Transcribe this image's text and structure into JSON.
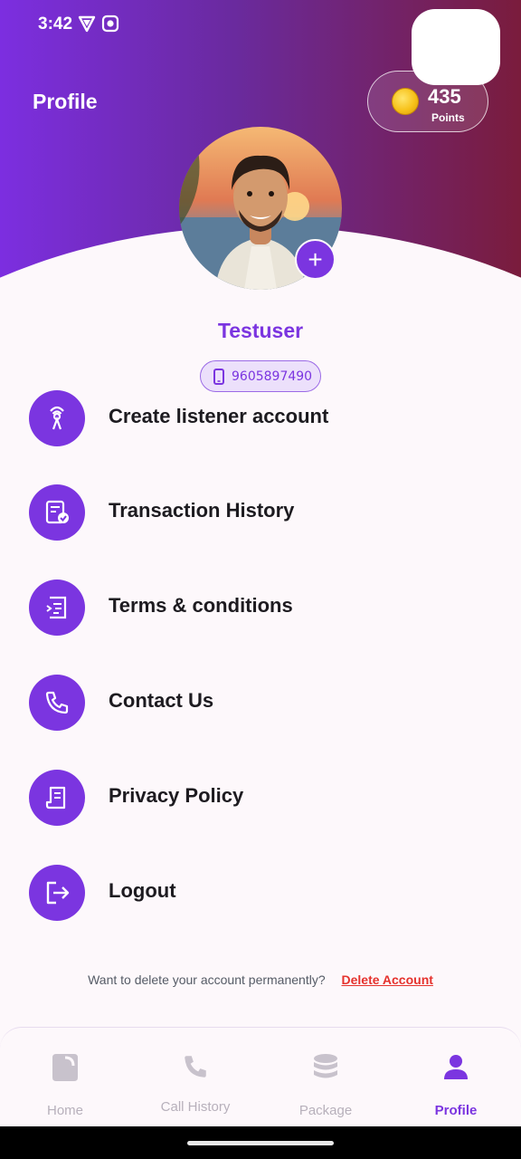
{
  "status_bar": {
    "time": "3:42"
  },
  "header": {
    "title": "Profile",
    "points": {
      "value": "435",
      "label": "Points"
    }
  },
  "profile": {
    "name": "Testuser",
    "phone": "9605897490"
  },
  "menu": [
    {
      "label": "Create listener account",
      "icon": "listener-icon"
    },
    {
      "label": "Transaction History",
      "icon": "transaction-icon"
    },
    {
      "label": "Terms & conditions",
      "icon": "terms-icon"
    },
    {
      "label": "Contact Us",
      "icon": "phone-icon"
    },
    {
      "label": "Privacy Policy",
      "icon": "document-icon"
    },
    {
      "label": "Logout",
      "icon": "logout-icon"
    }
  ],
  "delete_account": {
    "prompt": "Want to delete your account permanently?",
    "link": "Delete Account"
  },
  "bottom_nav": [
    {
      "label": "Home",
      "icon": "home-icon",
      "active": false
    },
    {
      "label": "Call History",
      "icon": "phone-icon",
      "active": false
    },
    {
      "label": "Package",
      "icon": "database-icon",
      "active": false
    },
    {
      "label": "Profile",
      "icon": "person-icon",
      "active": true
    }
  ],
  "colors": {
    "accent": "#7b35e0",
    "gradient_start": "#7c2ee0",
    "gradient_end": "#7a1c3c",
    "danger": "#e5322d"
  }
}
